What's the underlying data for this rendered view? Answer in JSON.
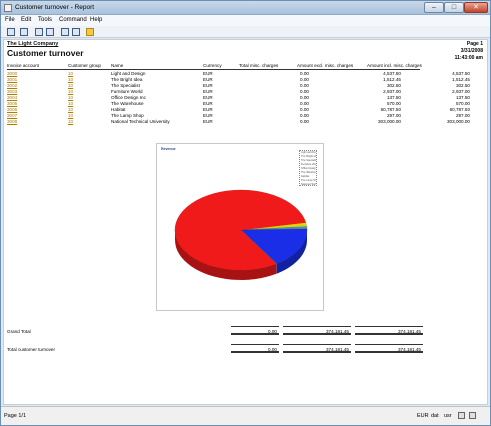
{
  "window": {
    "title": "Customer turnover - Report"
  },
  "menu": [
    "File",
    "Edit",
    "Tools",
    "Command",
    "Help"
  ],
  "toolbar": [
    "print-icon",
    "copy-icon",
    "first-page-icon",
    "prev-page-icon",
    "next-page-icon",
    "last-page-icon",
    "zoom-icon"
  ],
  "report": {
    "company": "The Light Company",
    "title": "Customer turnover",
    "page": "Page 1",
    "date": "3/31/2008",
    "time": "11:43:00 am",
    "columns": [
      "Invoice account",
      "Customer group",
      "Name",
      "Currency",
      "Total misc. charges",
      "Amount excl. misc. charges",
      "Amount incl. misc. charges"
    ],
    "rows": [
      [
        "3000",
        "10",
        "Light and Design",
        "EUR",
        "0.00",
        "4,537.50",
        "4,537.50"
      ],
      [
        "3001",
        "10",
        "The Bright Idea",
        "EUR",
        "0.00",
        "1,512.45",
        "1,512.45"
      ],
      [
        "3002",
        "10",
        "The Specialist",
        "EUR",
        "0.00",
        "302.50",
        "302.50"
      ],
      [
        "3003",
        "10",
        "Furniture World",
        "EUR",
        "0.00",
        "2,937.00",
        "2,937.00"
      ],
      [
        "3004",
        "10",
        "Office Design Inc",
        "EUR",
        "0.00",
        "137.50",
        "137.50"
      ],
      [
        "3005",
        "10",
        "The Warehouse",
        "EUR",
        "0.00",
        "570.00",
        "570.00"
      ],
      [
        "3006",
        "10",
        "Habitat",
        "EUR",
        "0.00",
        "60,787.50",
        "60,787.50"
      ],
      [
        "3007",
        "10",
        "The Lamp Shop",
        "EUR",
        "0.00",
        "297.00",
        "297.00"
      ],
      [
        "3008",
        "10",
        "National Technical University",
        "EUR",
        "0.00",
        "303,000.00",
        "303,000.00"
      ]
    ],
    "grand_total": {
      "label": "Grand Total",
      "misc": "0.00",
      "excl": "374,181.45",
      "incl": "374,181.45"
    },
    "total_turnover": {
      "label": "Total customer turnover",
      "misc": "0.00",
      "excl": "374,181.45",
      "incl": "374,181.45"
    }
  },
  "chart_data": {
    "type": "pie",
    "title": "Revenue",
    "categories": [
      "Light and Design",
      "The Bright Idea",
      "The Specialist",
      "Furniture World",
      "Office Design Inc",
      "The Warehouse",
      "Habitat",
      "The Lamp Shop",
      "National Technical University"
    ],
    "values": [
      4537.5,
      1512.45,
      302.5,
      2937.0,
      137.5,
      570.0,
      60787.5,
      297.0,
      303000.0
    ],
    "colors": [
      "#f0d000",
      "#e8e830",
      "#70c040",
      "#30a0d0",
      "#9050c0",
      "#c07030",
      "#1a2ee8",
      "#60c060",
      "#f01a1a"
    ],
    "legend": "top-right"
  },
  "status": {
    "page": "Page 1/1",
    "currency": "EUR",
    "company": "dat",
    "user": "usr"
  }
}
